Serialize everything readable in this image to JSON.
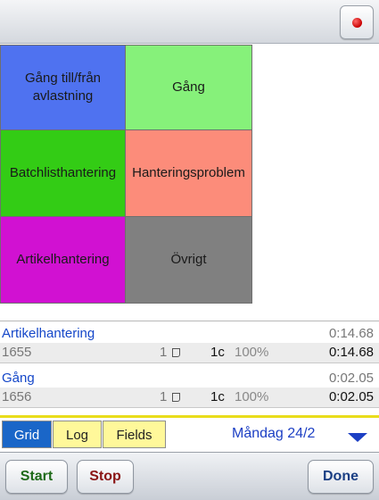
{
  "colors": {
    "tile_1": "#4f72f0",
    "tile_2": "#86f17a",
    "tile_3": "#33cc15",
    "tile_4": "#fc8c7a",
    "tile_5": "#d111d2",
    "tile_6": "#808080",
    "accent_blue": "#1547c9",
    "tab_active": "#1a66c8",
    "tab_inactive": "#fff89a"
  },
  "topbar": {
    "record_icon": "record-dot-icon"
  },
  "tiles": [
    {
      "label": "Gång till/från avlastning"
    },
    {
      "label": "Gång"
    },
    {
      "label": "Batchlisthantering"
    },
    {
      "label": "Hanteringsproblem"
    },
    {
      "label": "Artikelhantering"
    },
    {
      "label": "Övrigt"
    }
  ],
  "log": [
    {
      "activity": "Artikelhantering",
      "time": "0:14.68",
      "id": "1655",
      "count": "1",
      "note_icon": "note-icon",
      "c": "1c",
      "percent": "100%",
      "duration": "0:14.68"
    },
    {
      "activity": "Gång",
      "time": "0:02.05",
      "id": "1656",
      "count": "1",
      "note_icon": "note-icon",
      "c": "1c",
      "percent": "100%",
      "duration": "0:02.05"
    }
  ],
  "tabs": {
    "grid": "Grid",
    "log": "Log",
    "fields": "Fields",
    "date": "Måndag 24/2",
    "date_icon": "triangle-down-icon"
  },
  "buttons": {
    "start": "Start",
    "stop": "Stop",
    "done": "Done"
  }
}
